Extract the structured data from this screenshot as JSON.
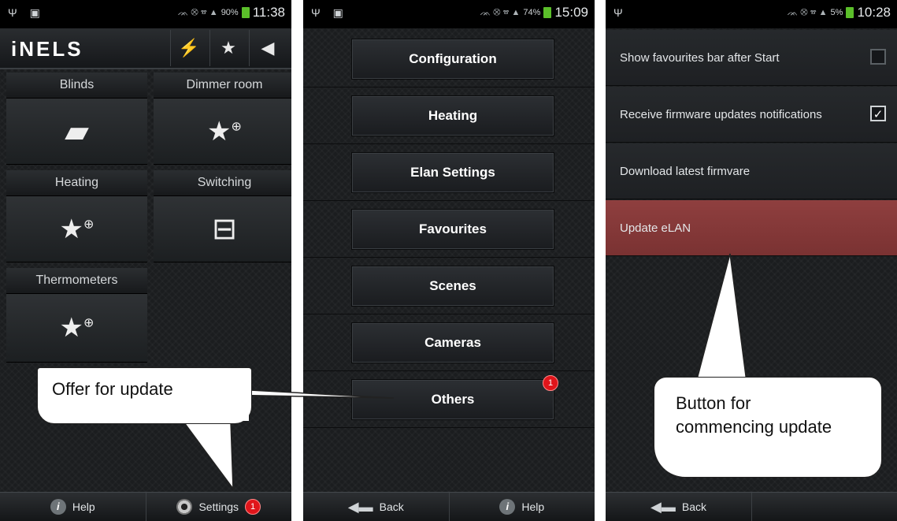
{
  "screen1": {
    "status": {
      "left": "Ψ ▣",
      "signal": "ᨏ ⨂ ☎ ▲",
      "battery": "90%",
      "time": "11:38"
    },
    "logo": "iNELS",
    "toolbar_icons": [
      "satellite-icon",
      "star-icon",
      "camera-icon"
    ],
    "tiles": [
      {
        "label": "Blinds",
        "icon": "blinds-icon",
        "glyph": "▰"
      },
      {
        "label": "Dimmer room",
        "icon": "star-plus-icon",
        "glyph": "★"
      },
      {
        "label": "Heating",
        "icon": "star-plus-icon",
        "glyph": "★"
      },
      {
        "label": "Switching",
        "icon": "toolbox-icon",
        "glyph": "⊟"
      },
      {
        "label": "Thermometers",
        "icon": "star-plus-icon",
        "glyph": "★"
      }
    ],
    "bottom": {
      "help": "Help",
      "settings": "Settings",
      "settings_badge": "1"
    }
  },
  "screen2": {
    "status": {
      "left": "Ψ ▣",
      "signal": "ᨏ ⨂ ☎ ▲",
      "battery": "74%",
      "time": "15:09"
    },
    "menu": [
      "Configuration",
      "Heating",
      "Elan Settings",
      "Favourites",
      "Scenes",
      "Cameras",
      "Others"
    ],
    "others_badge": "1",
    "bottom": {
      "back": "Back",
      "help": "Help"
    }
  },
  "screen3": {
    "status": {
      "left": "Ψ",
      "signal": "ᨏ ⨂ ☎ ▲",
      "battery": "5%",
      "time": "10:28"
    },
    "rows": [
      {
        "label": "Show favourites bar after Start",
        "checkbox": false
      },
      {
        "label": "Receive firmware updates notifications",
        "checkbox": true
      },
      {
        "label": "Download latest firmvare"
      },
      {
        "label": "Update eLAN",
        "highlight": true
      }
    ],
    "bottom": {
      "back": "Back"
    }
  },
  "callouts": {
    "offer": "Offer for update",
    "button_line1": "Button for",
    "button_line2": "commencing update"
  },
  "colors": {
    "highlight_row": "#8f3f3f",
    "badge": "#e0151b",
    "battery": "#5bbf2a"
  }
}
